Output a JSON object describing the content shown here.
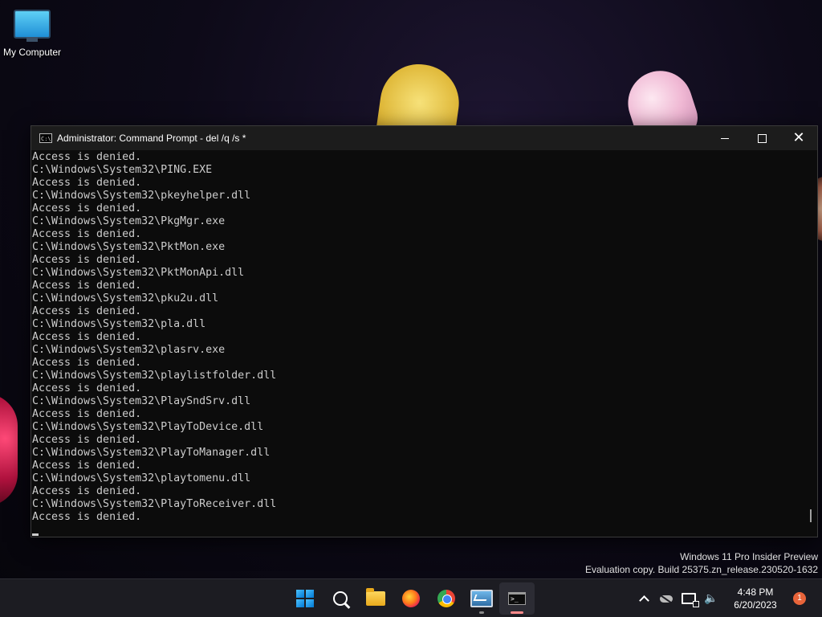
{
  "desktop": {
    "icons": [
      {
        "label": "My Computer",
        "icon": "monitor-icon"
      }
    ]
  },
  "window": {
    "title": "Administrator:  Command Prompt - del  /q /s *",
    "controls": {
      "minimize": "minimize-icon",
      "maximize": "maximize-icon",
      "close": "close-icon"
    },
    "console_lines": [
      "Access is denied.",
      "C:\\Windows\\System32\\PING.EXE",
      "Access is denied.",
      "C:\\Windows\\System32\\pkeyhelper.dll",
      "Access is denied.",
      "C:\\Windows\\System32\\PkgMgr.exe",
      "Access is denied.",
      "C:\\Windows\\System32\\PktMon.exe",
      "Access is denied.",
      "C:\\Windows\\System32\\PktMonApi.dll",
      "Access is denied.",
      "C:\\Windows\\System32\\pku2u.dll",
      "Access is denied.",
      "C:\\Windows\\System32\\pla.dll",
      "Access is denied.",
      "C:\\Windows\\System32\\plasrv.exe",
      "Access is denied.",
      "C:\\Windows\\System32\\playlistfolder.dll",
      "Access is denied.",
      "C:\\Windows\\System32\\PlaySndSrv.dll",
      "Access is denied.",
      "C:\\Windows\\System32\\PlayToDevice.dll",
      "Access is denied.",
      "C:\\Windows\\System32\\PlayToManager.dll",
      "Access is denied.",
      "C:\\Windows\\System32\\playtomenu.dll",
      "Access is denied.",
      "C:\\Windows\\System32\\PlayToReceiver.dll",
      "Access is denied."
    ]
  },
  "watermark": {
    "line1": "Windows 11 Pro Insider Preview",
    "line2": "Evaluation copy. Build 25375.zn_release.230520-1632"
  },
  "taskbar": {
    "apps": [
      {
        "name": "start",
        "icon": "windows-logo-icon"
      },
      {
        "name": "search",
        "icon": "search-icon"
      },
      {
        "name": "file-explorer",
        "icon": "folder-icon"
      },
      {
        "name": "firefox",
        "icon": "firefox-icon"
      },
      {
        "name": "chrome",
        "icon": "chrome-icon"
      },
      {
        "name": "performance-monitor",
        "icon": "monitor-chart-icon"
      },
      {
        "name": "command-prompt",
        "icon": "terminal-icon"
      }
    ],
    "tray": {
      "time": "4:48 PM",
      "date": "6/20/2023",
      "notification_count": "1"
    }
  }
}
